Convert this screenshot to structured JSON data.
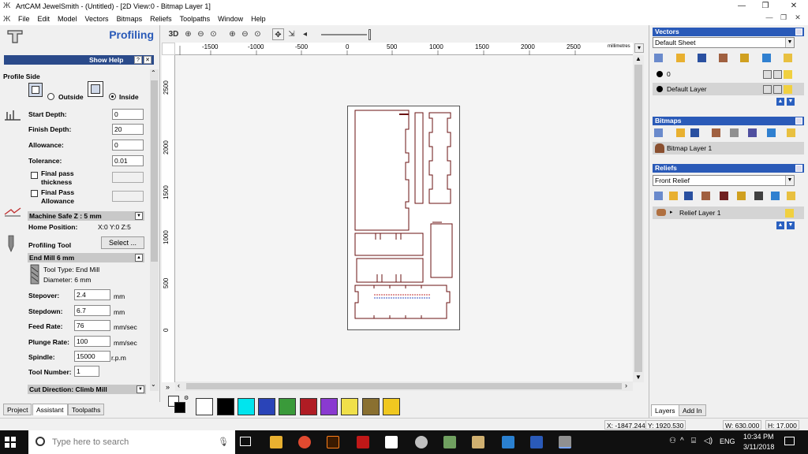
{
  "window": {
    "title": "ArtCAM JewelSmith - (Untitled) - [2D View:0 - Bitmap Layer 1]",
    "controls": [
      "—",
      "❐",
      "✕"
    ]
  },
  "menu": {
    "items": [
      "File",
      "Edit",
      "Model",
      "Vectors",
      "Bitmaps",
      "Reliefs",
      "Toolpaths",
      "Window",
      "Help"
    ],
    "mdi_controls": [
      "—",
      "❐",
      "✕"
    ]
  },
  "left_panel": {
    "title": "Profiling",
    "show_help": "Show Help",
    "help_btn": "?",
    "close_btn": "✕",
    "profile_side_label": "Profile Side",
    "outside_label": "Outside",
    "inside_label": "Inside",
    "selected_side": "Inside",
    "start_depth_label": "Start Depth:",
    "start_depth_value": "0",
    "finish_depth_label": "Finish Depth:",
    "finish_depth_value": "20",
    "allowance_label": "Allowance:",
    "allowance_value": "0",
    "tolerance_label": "Tolerance:",
    "tolerance_value": "0.01",
    "final_pass_thickness_label_1": "Final pass",
    "final_pass_thickness_label_2": "thickness",
    "final_pass_allowance_label_1": "Final Pass",
    "final_pass_allowance_label_2": "Allowance",
    "machine_safe_z": "Machine Safe Z : 5 mm",
    "home_position_label": "Home Position:",
    "home_position_value": "X:0 Y:0 Z:5",
    "profiling_tool_label": "Profiling Tool",
    "select_button": "Select ...",
    "tool_header": "End Mill 6 mm",
    "tool_type": "Tool Type: End Mill",
    "diameter": "Diameter: 6 mm",
    "stepover_label": "Stepover:",
    "stepover_value": "2.4",
    "stepdown_label": "Stepdown:",
    "stepdown_value": "6.7",
    "feed_rate_label": "Feed Rate:",
    "feed_rate_value": "76",
    "plunge_rate_label": "Plunge Rate:",
    "plunge_rate_value": "100",
    "spindle_label": "Spindle:",
    "spindle_value": "15000",
    "tool_number_label": "Tool Number:",
    "tool_number_value": "1",
    "mm": "mm",
    "mm_sec": "mm/sec",
    "rpm": "r.p.m",
    "cut_direction": "Cut Direction: Climb Mill",
    "tabs": [
      "Project",
      "Assistant",
      "Toolpaths"
    ],
    "active_tab": "Assistant"
  },
  "view_toolbar": {
    "label_3d": "3D"
  },
  "ruler": {
    "h_ticks": [
      "-1500",
      "-1000",
      "-500",
      "0",
      "500",
      "1000",
      "1500",
      "2000",
      "2500"
    ],
    "unit": "millimetres",
    "v_ticks": [
      "2500",
      "2000",
      "1500",
      "1000",
      "500",
      "0"
    ]
  },
  "palette": {
    "colors": [
      "#ffffff",
      "#000000",
      "#00e5ee",
      "#2a44b8",
      "#3a9a3a",
      "#b01c24",
      "#8a3ad0",
      "#f0e04a",
      "#8a7030",
      "#f0c820"
    ]
  },
  "right_panel": {
    "vectors_header": "Vectors",
    "vectors_combo": "Default Sheet",
    "vector_layer_0": "0",
    "vector_layer_default": "Default Layer",
    "bitmaps_header": "Bitmaps",
    "bitmap_layer": "Bitmap Layer 1",
    "reliefs_header": "Reliefs",
    "reliefs_combo": "Front Relief",
    "relief_layer": "Relief Layer 1",
    "tabs": [
      "Layers",
      "Add In"
    ]
  },
  "status": {
    "x": "X: -1847.244",
    "y": "Y: 1920.530",
    "w": "W: 630.000",
    "h": "H: 17.000"
  },
  "taskbar": {
    "search_placeholder": "Type here to search",
    "lang": "ENG",
    "time": "10:34 PM",
    "date": "3/11/2018"
  }
}
